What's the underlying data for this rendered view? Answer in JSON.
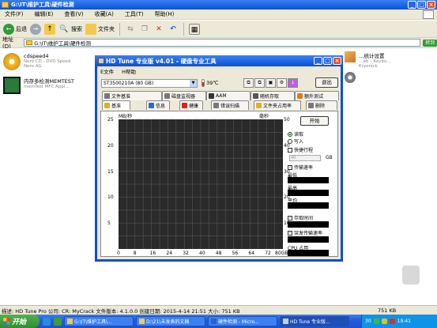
{
  "explorer": {
    "title": "G:\\IT\\维护工具\\硬件检测",
    "menu": [
      "文件(F)",
      "编辑(E)",
      "查看(V)",
      "收藏(A)",
      "工具(T)",
      "帮助(H)"
    ],
    "toolbar": {
      "back": "后退",
      "search": "搜索",
      "folders": "文件夹"
    },
    "address_label": "地址(D)",
    "address": "G:\\IT\\维护工具\\硬件检测",
    "go": "转到",
    "items": [
      {
        "name": "cdspeed4",
        "sub": "Nero CD - DVD Speed",
        "sub2": "Nero AG",
        "icon": "cd-icon"
      },
      {
        "name": "内存多检测MEMTEST",
        "sub": "memTest MFC Appl...",
        "icon": "chip-icon"
      },
      {
        "name": "…统计设置",
        "sub": "…ab – Keybo…",
        "sub2": "Kryonick",
        "icon": "cube-icon"
      }
    ],
    "status": "描述: HD Tune Pro 公司: CR: MyCrack 文件版本: 4.1.0.0 创建日期: 2015-4-14 21:51 大小: 751 KB",
    "status_right": "751 KB"
  },
  "hdtune": {
    "title": "HD Tune 专业版 v4.01 - 硬盘专业工具",
    "menu": [
      "E文件",
      "H帮助"
    ],
    "drive": "ST3500210A (80 GB)",
    "temperature": "39℃",
    "exit": "退出",
    "tabs_top": [
      "文件基准",
      "磁盘监视器",
      "AAM",
      "随机存取",
      "额外测试"
    ],
    "tabs_bottom": [
      "基准",
      "信息",
      "健康",
      "错误扫描",
      "文件夹占用率",
      "删除"
    ],
    "y_unit_left": "MB/秒",
    "y_unit_right": "毫秒",
    "y_ticks": [
      "25",
      "20",
      "15",
      "10",
      "5"
    ],
    "y_ticks_right": [
      "50",
      "40",
      "30",
      "20",
      "10"
    ],
    "x_ticks": [
      "0",
      "8",
      "16",
      "24",
      "32",
      "40",
      "48",
      "56",
      "64",
      "72",
      "80GB"
    ],
    "start": "开始",
    "read": "读取",
    "write": "写入",
    "short_stroke": "快捷行程",
    "short_value": "40",
    "gb": "GB",
    "transfer_rate": "传输速率",
    "min": "最低",
    "max": "最高",
    "avg": "平均",
    "access_time": "存取时间",
    "burst_rate": "突发传输速率",
    "cpu": "CPU 占用"
  },
  "taskbar": {
    "start": "开始",
    "tasks": [
      "G:\\IT\\维护工具\\...",
      "D:\\21\\未发表的文稿",
      "硬件检测 - Micro...",
      "HD Tune 专业版..."
    ],
    "clock": "19:41",
    "tray_num": "30"
  }
}
